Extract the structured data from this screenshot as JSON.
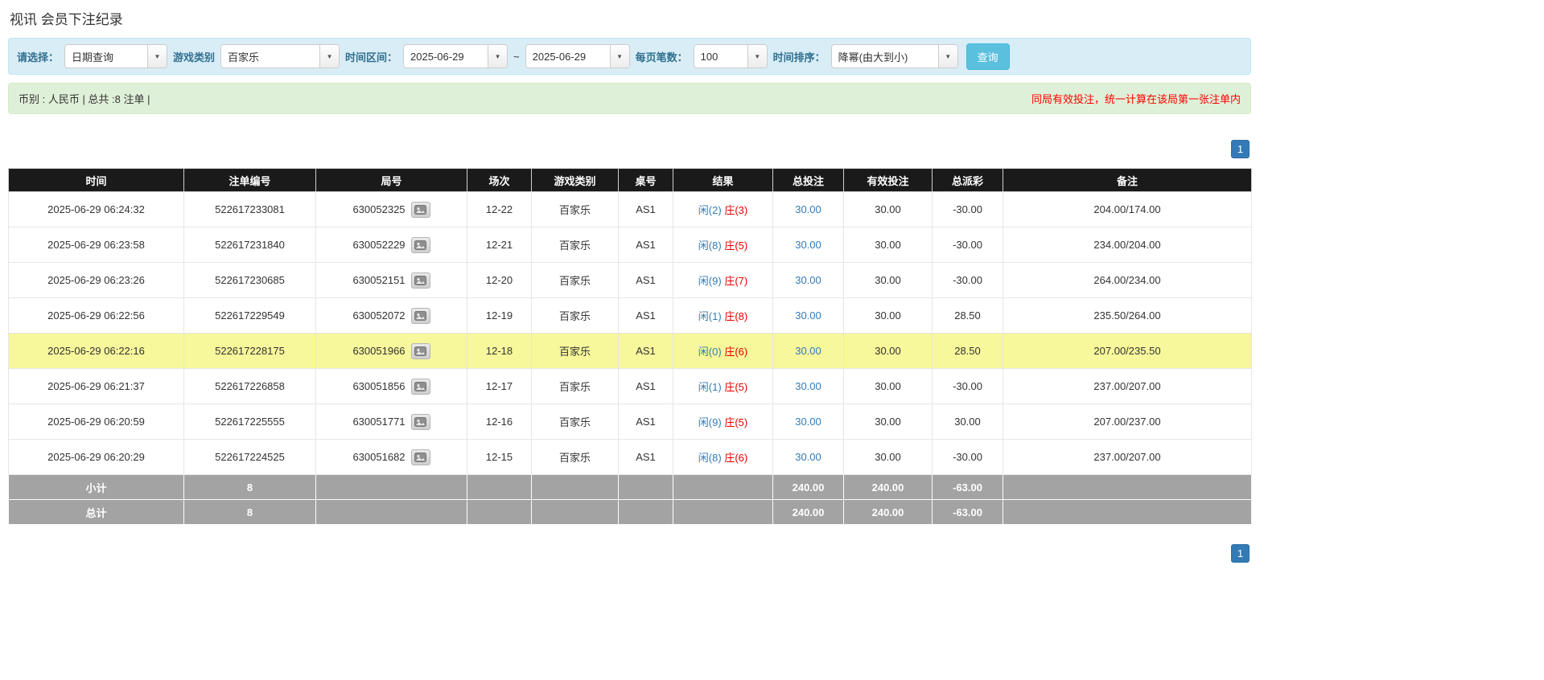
{
  "page": {
    "title": "视讯 会员下注纪录"
  },
  "icons": {
    "dropdown_caret": "▼"
  },
  "filters": {
    "select_label": "请选择：",
    "select_value": "日期查询",
    "game_type_label": "游戏类别",
    "game_type_value": "百家乐",
    "date_range_label": "时间区间：",
    "date_from": "2025-06-29",
    "date_separator": "~",
    "date_to": "2025-06-29",
    "page_size_label": "每页笔数：",
    "page_size_value": "100",
    "sort_label": "时间排序：",
    "sort_value": "降幂(由大到小)",
    "search_button": "查询"
  },
  "summary": {
    "left": "币别 : 人民币 | 总共 :8 注单 |",
    "right": "同局有效投注，统一计算在该局第一张注单内"
  },
  "pagination": {
    "page": "1"
  },
  "table": {
    "headers": [
      "时间",
      "注单编号",
      "局号",
      "场次",
      "游戏类别",
      "桌号",
      "结果",
      "总投注",
      "有效投注",
      "总派彩",
      "备注"
    ],
    "rows": [
      {
        "time": "2025-06-29 06:24:32",
        "bet_id": "522617233081",
        "round_id": "630052325",
        "session": "12-22",
        "game": "百家乐",
        "table_no": "AS1",
        "result_player": "闲(2)",
        "result_banker": "庄(3)",
        "total_bet": "30.00",
        "valid_bet": "30.00",
        "payout": "-30.00",
        "remark": "204.00/174.00",
        "highlight": false
      },
      {
        "time": "2025-06-29 06:23:58",
        "bet_id": "522617231840",
        "round_id": "630052229",
        "session": "12-21",
        "game": "百家乐",
        "table_no": "AS1",
        "result_player": "闲(8)",
        "result_banker": "庄(5)",
        "total_bet": "30.00",
        "valid_bet": "30.00",
        "payout": "-30.00",
        "remark": "234.00/204.00",
        "highlight": false
      },
      {
        "time": "2025-06-29 06:23:26",
        "bet_id": "522617230685",
        "round_id": "630052151",
        "session": "12-20",
        "game": "百家乐",
        "table_no": "AS1",
        "result_player": "闲(9)",
        "result_banker": "庄(7)",
        "total_bet": "30.00",
        "valid_bet": "30.00",
        "payout": "-30.00",
        "remark": "264.00/234.00",
        "highlight": false
      },
      {
        "time": "2025-06-29 06:22:56",
        "bet_id": "522617229549",
        "round_id": "630052072",
        "session": "12-19",
        "game": "百家乐",
        "table_no": "AS1",
        "result_player": "闲(1)",
        "result_banker": "庄(8)",
        "total_bet": "30.00",
        "valid_bet": "30.00",
        "payout": "28.50",
        "remark": "235.50/264.00",
        "highlight": false
      },
      {
        "time": "2025-06-29 06:22:16",
        "bet_id": "522617228175",
        "round_id": "630051966",
        "session": "12-18",
        "game": "百家乐",
        "table_no": "AS1",
        "result_player": "闲(0)",
        "result_banker": "庄(6)",
        "total_bet": "30.00",
        "valid_bet": "30.00",
        "payout": "28.50",
        "remark": "207.00/235.50",
        "highlight": true
      },
      {
        "time": "2025-06-29 06:21:37",
        "bet_id": "522617226858",
        "round_id": "630051856",
        "session": "12-17",
        "game": "百家乐",
        "table_no": "AS1",
        "result_player": "闲(1)",
        "result_banker": "庄(5)",
        "total_bet": "30.00",
        "valid_bet": "30.00",
        "payout": "-30.00",
        "remark": "237.00/207.00",
        "highlight": false
      },
      {
        "time": "2025-06-29 06:20:59",
        "bet_id": "522617225555",
        "round_id": "630051771",
        "session": "12-16",
        "game": "百家乐",
        "table_no": "AS1",
        "result_player": "闲(9)",
        "result_banker": "庄(5)",
        "total_bet": "30.00",
        "valid_bet": "30.00",
        "payout": "30.00",
        "remark": "207.00/237.00",
        "highlight": false
      },
      {
        "time": "2025-06-29 06:20:29",
        "bet_id": "522617224525",
        "round_id": "630051682",
        "session": "12-15",
        "game": "百家乐",
        "table_no": "AS1",
        "result_player": "闲(8)",
        "result_banker": "庄(6)",
        "total_bet": "30.00",
        "valid_bet": "30.00",
        "payout": "-30.00",
        "remark": "237.00/207.00",
        "highlight": false
      }
    ],
    "subtotal": {
      "label": "小计",
      "count": "8",
      "total_bet": "240.00",
      "valid_bet": "240.00",
      "payout": "-63.00"
    },
    "total": {
      "label": "总计",
      "count": "8",
      "total_bet": "240.00",
      "valid_bet": "240.00",
      "payout": "-63.00"
    }
  }
}
